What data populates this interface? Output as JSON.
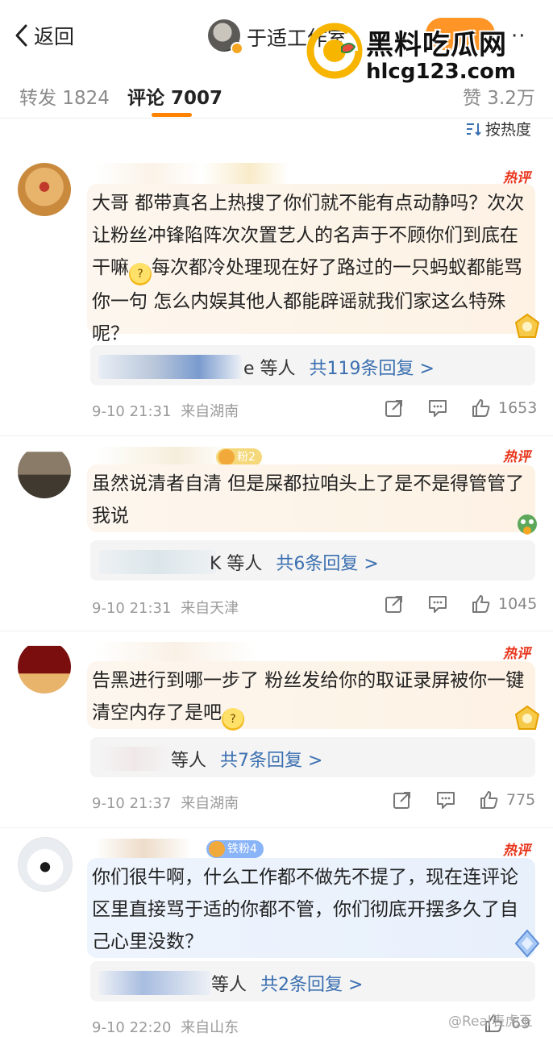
{
  "nav": {
    "back_label": "返回",
    "title": "于适工作室",
    "more": "··"
  },
  "watermark": {
    "brand": "黑料吃瓜网",
    "url": "hlcg123.com"
  },
  "tabs": [
    {
      "label": "转发 1824"
    },
    {
      "label": "评论 7007"
    },
    {
      "label": "赞 3.2万"
    }
  ],
  "sort_label": "按热度",
  "hot_label": "热评",
  "comments": [
    {
      "content_parts": [
        "大哥 都带真名上热搜了你们就不能有点动静吗？次次让粉丝冲锋陷阵次次置艺人的名声于不顾你们到底在干嘛",
        "每次都冷处理现在好了路过的一只蚂蚁都能骂你一句 怎么内娱其他人都能辟谣就我们家这么特殊呢？"
      ],
      "reply_suffix": "e 等人",
      "reply_link": "共119条回复 >",
      "time": "9-10 21:31",
      "location": "来自湖南",
      "likes": "1653"
    },
    {
      "fan_badge": "粉2",
      "content_parts": [
        "虽然说清者自清 但是屎都拉咱头上了是不是得管管了我说"
      ],
      "reply_suffix": "K 等人",
      "reply_link": "共6条回复 >",
      "time": "9-10 21:31",
      "location": "来自天津",
      "likes": "1045"
    },
    {
      "content_parts": [
        "告黑进行到哪一步了 粉丝发给你的取证录屏被你一键清空内存了是吧"
      ],
      "reply_suffix": "等人",
      "reply_link": "共7条回复 >",
      "time": "9-10 21:37",
      "location": "来自湖南",
      "likes": "775"
    },
    {
      "fan_badge": "铁粉4",
      "content_parts": [
        "你们很牛啊，什么工作都不做先不提了，现在连评论区里直接骂于适的你都不管，你们彻底开摆多久了自己心里没数？"
      ],
      "reply_suffix": "等人",
      "reply_link": "共2条回复 >",
      "time": "9-10 22:20",
      "location": "来自山东",
      "likes": "69"
    }
  ],
  "corner_watermark": "@Real表虎王",
  "colors": {
    "accent": "#ff8200",
    "hot": "#e8341a",
    "link": "#3a6fb0"
  }
}
